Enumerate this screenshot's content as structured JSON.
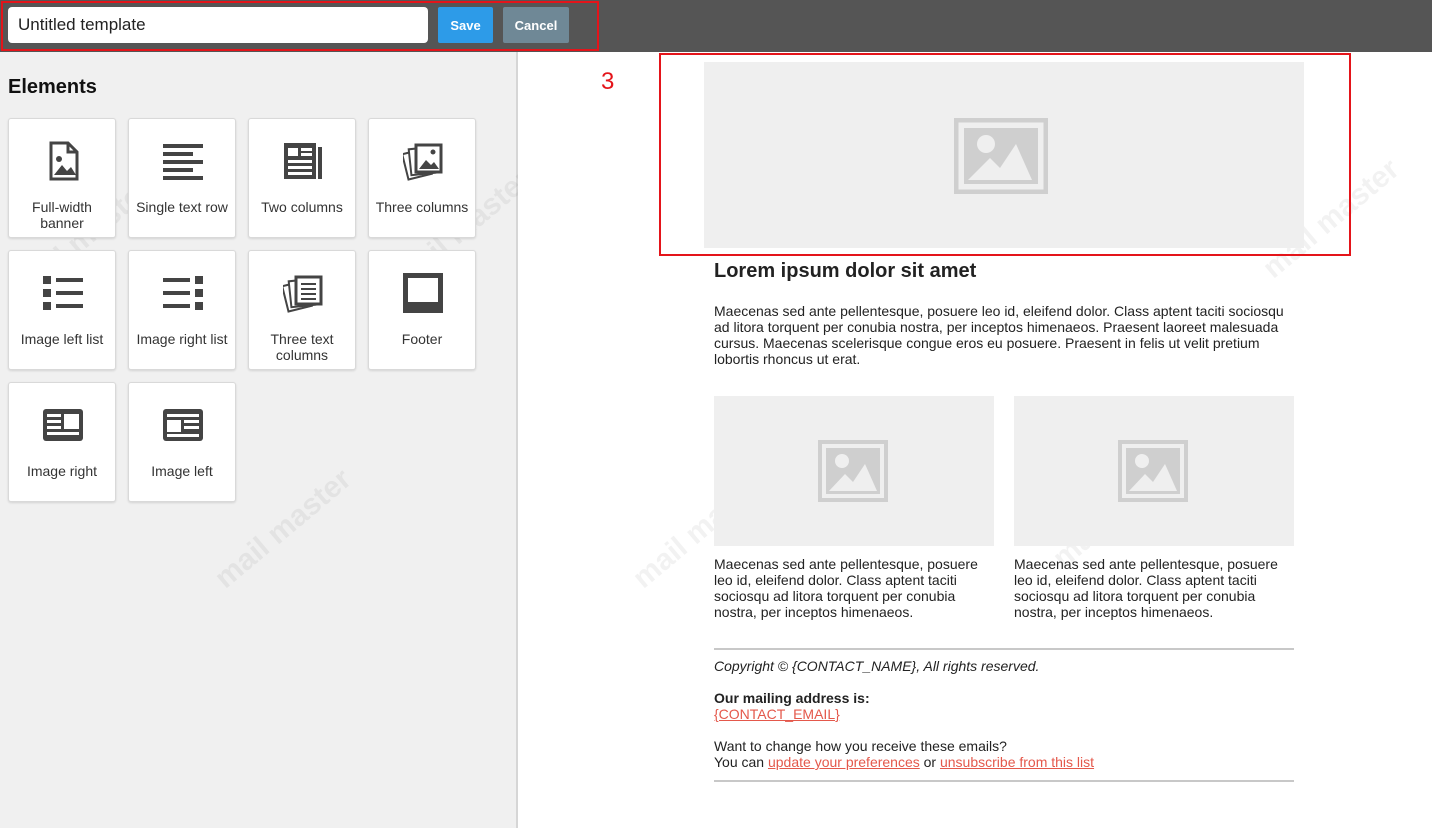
{
  "toolbar": {
    "template_name": "Untitled template",
    "save_label": "Save",
    "cancel_label": "Cancel"
  },
  "sidebar": {
    "title": "Elements",
    "tiles": [
      {
        "label": "Full-width banner",
        "icon": "image-file-icon"
      },
      {
        "label": "Single text row",
        "icon": "text-lines-icon"
      },
      {
        "label": "Two columns",
        "icon": "two-columns-icon"
      },
      {
        "label": "Three columns",
        "icon": "stacked-images-icon"
      },
      {
        "label": "Image left list",
        "icon": "bullet-list-icon"
      },
      {
        "label": "Image right list",
        "icon": "right-list-icon"
      },
      {
        "label": "Three text columns",
        "icon": "stacked-documents-icon"
      },
      {
        "label": "Footer",
        "icon": "footer-frame-icon"
      },
      {
        "label": "Image right",
        "icon": "article-image-right-icon"
      },
      {
        "label": "Image left",
        "icon": "article-image-left-icon"
      }
    ]
  },
  "annotation": {
    "number": "3"
  },
  "preview": {
    "heading": "Lorem ipsum dolor sit amet",
    "paragraph": "Maecenas sed ante pellentesque, posuere leo id, eleifend dolor. Class aptent taciti sociosqu ad litora torquent per conubia nostra, per inceptos himenaeos. Praesent laoreet malesuada cursus. Maecenas scelerisque congue eros eu posuere. Praesent in felis ut velit pretium lobortis rhoncus ut erat.",
    "columns": [
      {
        "text": "Maecenas sed ante pellentesque, posuere leo id, eleifend dolor. Class aptent taciti sociosqu ad litora torquent per conubia nostra, per inceptos himenaeos."
      },
      {
        "text": "Maecenas sed ante pellentesque, posuere leo id, eleifend dolor. Class aptent taciti sociosqu ad litora torquent per conubia nostra, per inceptos himenaeos."
      }
    ],
    "footer": {
      "copyright": "Copyright © {CONTACT_NAME}, All rights reserved.",
      "address_title": "Our mailing address is:",
      "contact_email": "{CONTACT_EMAIL}",
      "change_line": "Want to change how you receive these emails?",
      "you_can": "You can",
      "update_link": "update your preferences",
      "or": "or",
      "unsubscribe_link": "unsubscribe from this list"
    }
  },
  "watermark": "mail master",
  "colors": {
    "topbar": "#555555",
    "save": "#2d9be8",
    "cancel": "#6f8896",
    "highlight": "#e4141a",
    "link": "#e4584b",
    "placeholder": "#efefef"
  }
}
